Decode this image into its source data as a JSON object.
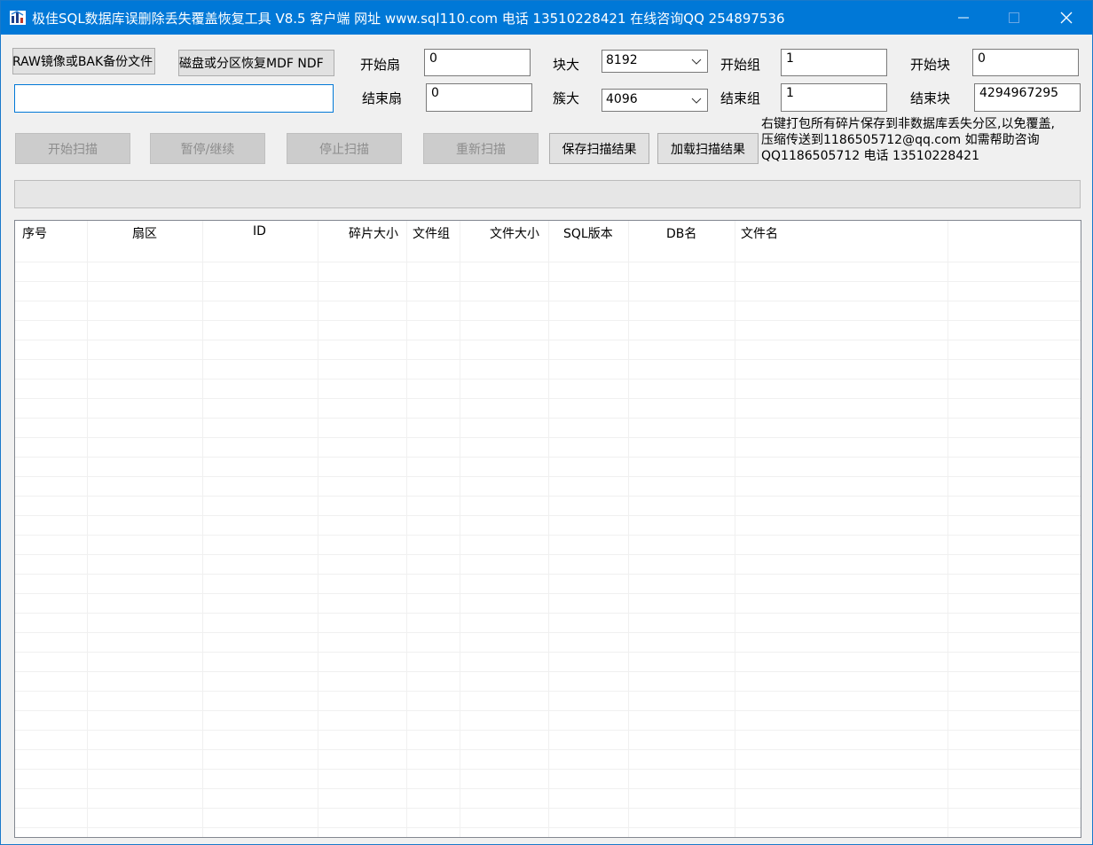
{
  "window": {
    "title": "极佳SQL数据库误删除丢失覆盖恢复工具 V8.5 客户端 网址 www.sql110.com  电话 13510228421 在线咨询QQ 254897536"
  },
  "buttons": {
    "open_raw": "RAW镜像或BAK备份文件",
    "recover_from_disk": "从磁盘或分区恢复MDF NDF",
    "start_scan": "开始扫描",
    "pause_resume": "暂停/继续",
    "stop_scan": "停止扫描",
    "rescan": "重新扫描",
    "save_results": "保存扫描结果",
    "load_results": "加载扫描结果"
  },
  "path_input": {
    "value": ""
  },
  "params": {
    "start_sector_label": "开始扇",
    "start_sector_value": "0",
    "end_sector_label": "结束扇",
    "end_sector_value": "0",
    "block_size_label": "块大",
    "block_size_value": "8192",
    "cluster_size_label": "簇大",
    "cluster_size_value": "4096",
    "start_group_label": "开始组",
    "start_group_value": "1",
    "end_group_label": "结束组",
    "end_group_value": "1",
    "start_block_label": "开始块",
    "start_block_value": "0",
    "end_block_label": "结束块",
    "end_block_value": "4294967295"
  },
  "info": {
    "line1": "右键打包所有碎片保存到非数据库丢失分区,以免覆盖,",
    "line2": "压缩传送到1186505712@qq.com 如需帮助咨询",
    "line3": "QQ1186505712 电话 13510228421"
  },
  "progress": {
    "value": 0
  },
  "table": {
    "columns": [
      "序号",
      "扇区",
      "ID",
      "碎片大小",
      "文件组",
      "文件大小",
      "SQL版本",
      "DB名",
      "文件名"
    ],
    "rows": []
  }
}
